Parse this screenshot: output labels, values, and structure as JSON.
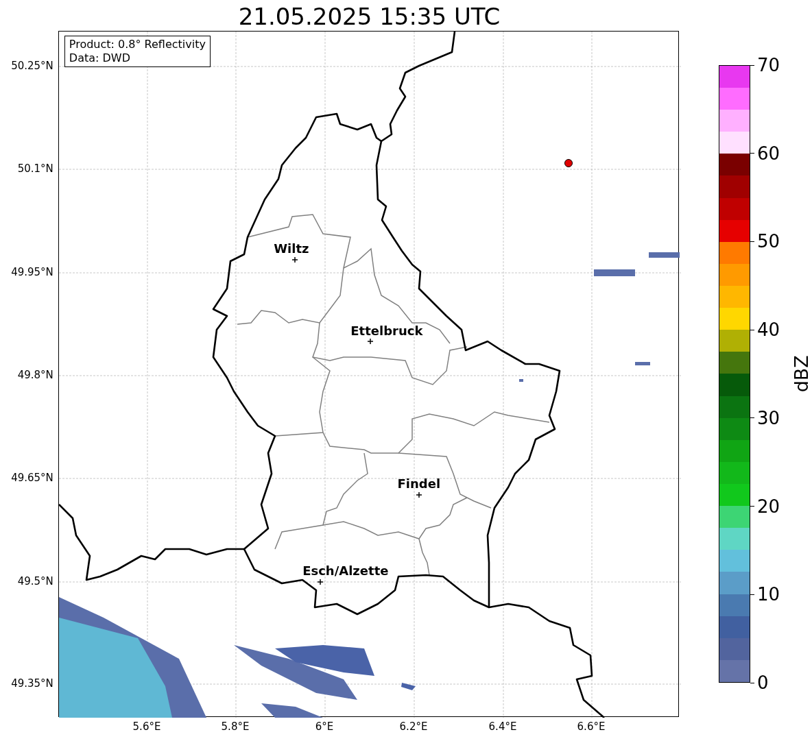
{
  "title": "21.05.2025 15:35 UTC",
  "info_box": {
    "lines": [
      "Product: 0.8° Reflectivity",
      "Data: DWD"
    ]
  },
  "map": {
    "y_ticks": [
      "50.25°N",
      "50.1°N",
      "49.95°N",
      "49.8°N",
      "49.65°N",
      "49.5°N",
      "49.35°N"
    ],
    "x_ticks": [
      "5.6°E",
      "5.8°E",
      "6°E",
      "6.2°E",
      "6.4°E",
      "6.6°E"
    ],
    "cities": [
      {
        "name": "Wiltz"
      },
      {
        "name": "Ettelbruck"
      },
      {
        "name": "Findel"
      },
      {
        "name": "Esch/Alzette"
      }
    ]
  },
  "colorbar": {
    "label": "dBZ",
    "ticks": [
      "70",
      "60",
      "50",
      "40",
      "30",
      "20",
      "10",
      "0"
    ],
    "bins": [
      {
        "color": "#6573a8"
      },
      {
        "color": "#52649e"
      },
      {
        "color": "#4160a0"
      },
      {
        "color": "#4a7ab0"
      },
      {
        "color": "#5b9dc8"
      },
      {
        "color": "#62c0dc"
      },
      {
        "color": "#5fd6c4"
      },
      {
        "color": "#3dd574"
      },
      {
        "color": "#11c81c"
      },
      {
        "color": "#12b81a"
      },
      {
        "color": "#10a514"
      },
      {
        "color": "#0e8a14"
      },
      {
        "color": "#0b7411"
      },
      {
        "color": "#065a0a"
      },
      {
        "color": "#45760d"
      },
      {
        "color": "#b0b004"
      },
      {
        "color": "#ffd700"
      },
      {
        "color": "#ffb700"
      },
      {
        "color": "#ff9a00"
      },
      {
        "color": "#ff7a00"
      },
      {
        "color": "#e60000"
      },
      {
        "color": "#c00000"
      },
      {
        "color": "#a00000"
      },
      {
        "color": "#7a0000"
      },
      {
        "color": "#ffe0ff"
      },
      {
        "color": "#ffb0ff"
      },
      {
        "color": "#ff6cff"
      },
      {
        "color": "#e838f0"
      }
    ]
  }
}
